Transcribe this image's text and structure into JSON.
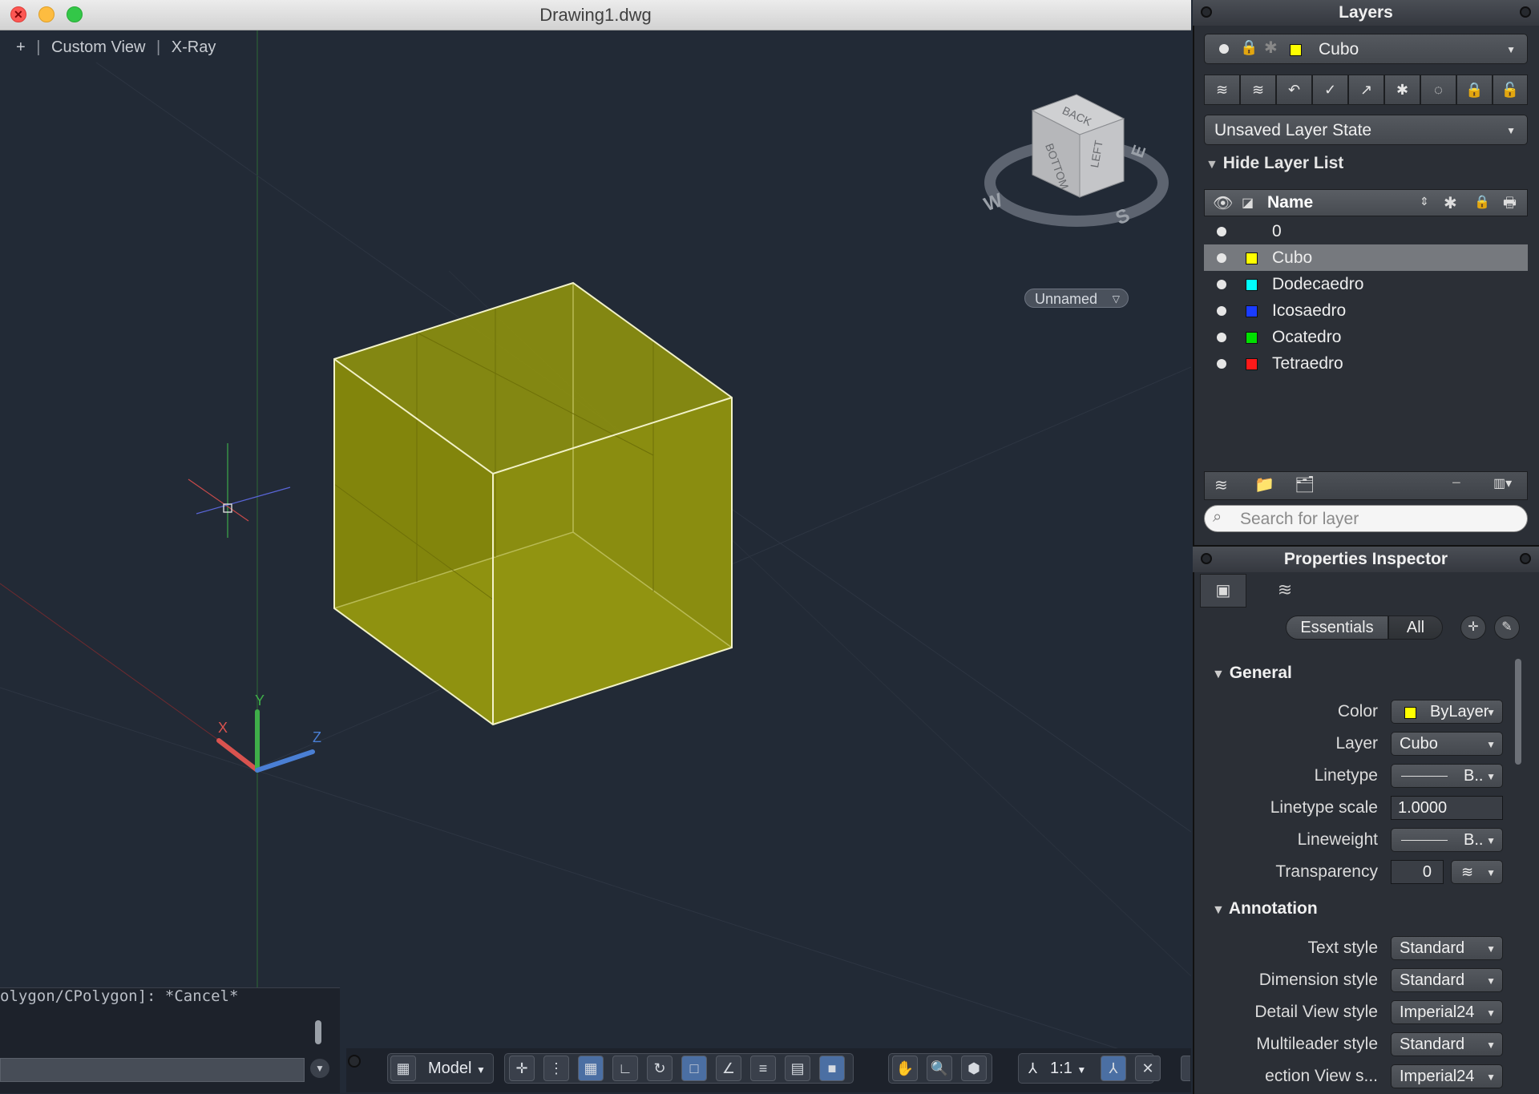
{
  "window": {
    "title": "Drawing1.dwg"
  },
  "viewport": {
    "controls": {
      "plus": "+",
      "separator": "|",
      "view": "Custom View",
      "style": "X-Ray"
    },
    "viewcube": {
      "faces": [
        "BACK",
        "BOTTOM",
        "LEFT"
      ],
      "compass": [
        "W",
        "S",
        "E"
      ]
    },
    "named_view": "Unnamed",
    "ucs_axes": [
      "X",
      "Y",
      "Z"
    ],
    "object_color": "#8a8d10"
  },
  "command_line": {
    "history": "olygon/CPolygon]: *Cancel*",
    "input_value": ""
  },
  "statusbar": {
    "model_label": "Model",
    "scale_label": "1:1"
  },
  "layers_panel": {
    "title": "Layers",
    "current_layer": {
      "name": "Cubo",
      "color": "#ffff00"
    },
    "layer_state": "Unsaved Layer State",
    "hide_list_label": "Hide Layer List",
    "columns": {
      "name": "Name"
    },
    "layers": [
      {
        "name": "0",
        "color": "",
        "selected": false
      },
      {
        "name": "Cubo",
        "color": "#ffff00",
        "selected": true
      },
      {
        "name": "Dodecaedro",
        "color": "#00ffff",
        "selected": false
      },
      {
        "name": "Icosaedro",
        "color": "#1a3cff",
        "selected": false
      },
      {
        "name": "Ocatedro",
        "color": "#00e000",
        "selected": false
      },
      {
        "name": "Tetraedro",
        "color": "#ff1a1a",
        "selected": false
      }
    ],
    "search_placeholder": "Search for layer"
  },
  "properties_panel": {
    "title": "Properties Inspector",
    "modes": {
      "essentials": "Essentials",
      "all": "All"
    },
    "general": {
      "heading": "General",
      "color": {
        "label": "Color",
        "value": "ByLayer",
        "swatch": "#ffff00"
      },
      "layer": {
        "label": "Layer",
        "value": "Cubo"
      },
      "linetype": {
        "label": "Linetype",
        "value": "B.."
      },
      "linetype_scale": {
        "label": "Linetype scale",
        "value": "1.0000"
      },
      "lineweight": {
        "label": "Lineweight",
        "value": "B.."
      },
      "transparency": {
        "label": "Transparency",
        "value": "0"
      }
    },
    "annotation": {
      "heading": "Annotation",
      "text_style": {
        "label": "Text style",
        "value": "Standard"
      },
      "dimension_style": {
        "label": "Dimension style",
        "value": "Standard"
      },
      "detail_view_style": {
        "label": "Detail View style",
        "value": "Imperial24"
      },
      "multileader_style": {
        "label": "Multileader style",
        "value": "Standard"
      },
      "section_view_style": {
        "label": "ection View s...",
        "value": "Imperial24"
      }
    }
  }
}
